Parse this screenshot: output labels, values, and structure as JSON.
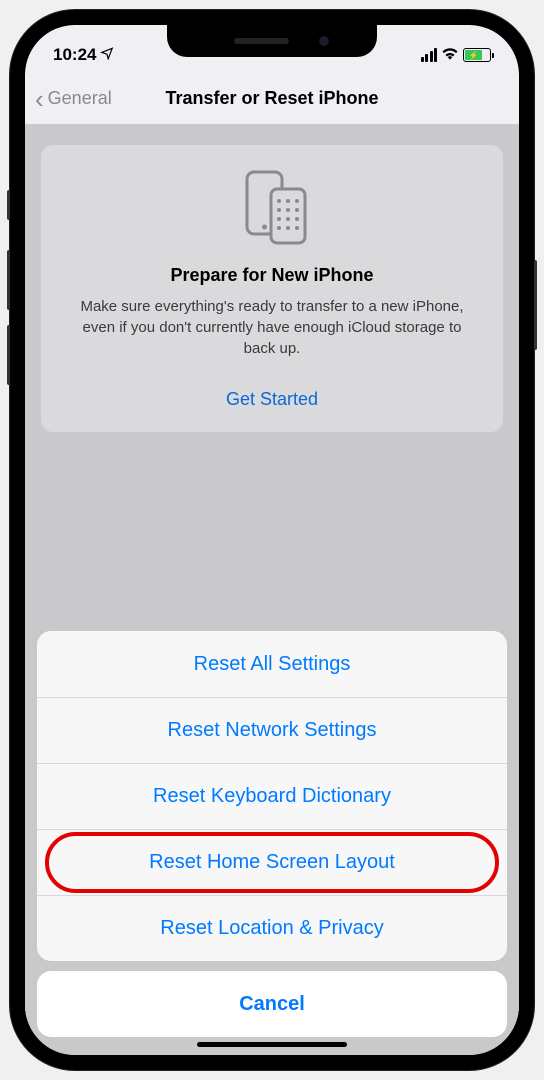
{
  "statusBar": {
    "time": "10:24"
  },
  "nav": {
    "backLabel": "General",
    "title": "Transfer or Reset iPhone"
  },
  "prepareCard": {
    "title": "Prepare for New iPhone",
    "description": "Make sure everything's ready to transfer to a new iPhone, even if you don't currently have enough iCloud storage to back up.",
    "linkLabel": "Get Started"
  },
  "actionSheet": {
    "items": [
      {
        "label": "Reset All Settings"
      },
      {
        "label": "Reset Network Settings"
      },
      {
        "label": "Reset Keyboard Dictionary"
      },
      {
        "label": "Reset Home Screen Layout"
      },
      {
        "label": "Reset Location & Privacy"
      }
    ],
    "cancelLabel": "Cancel"
  }
}
